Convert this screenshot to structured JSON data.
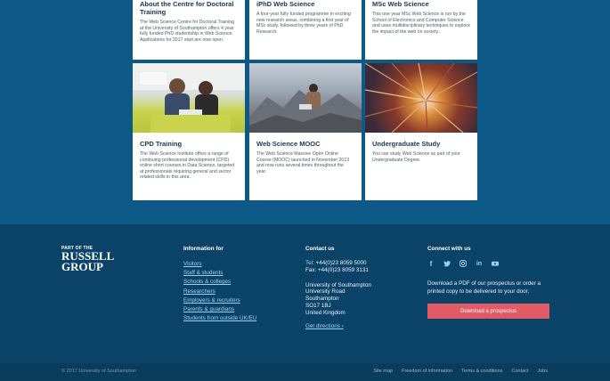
{
  "cards": [
    {
      "title": "About the Centre for Doctoral Training",
      "text": "The Web Science Centre for Doctoral Training at the University of Southampton offers 4 year fully funded PhD studentship in Web Science. Applications for 2017 start are now open."
    },
    {
      "title": "iPhD Web Science",
      "text": "A four-year fully funded programme in exciting new research areas, combining a first year of MSc study, followed by three years of PhD Research."
    },
    {
      "title": "MSc Web Science",
      "text": "This one year MSc Web Science is run by the School of Electronics and Computer Science and uses multidisciplinary techniques to explore the impact of the web on society."
    },
    {
      "title": "CPD Training",
      "text": "The Web Science Institute offers a range of continuing professional development (CPD) online short courses in Data Science, targeted at professionals requiring general and sector related skills in this area."
    },
    {
      "title": "Web Science MOOC",
      "text": "The Web Science Massive Open Online Course (MOOC) launched in November 2013 and now runs several times throughout the year."
    },
    {
      "title": "Undergraduate Study",
      "text": "You can study Web Science as part of your Undergraduate Degree."
    }
  ],
  "footer": {
    "russell_part": "PART OF THE",
    "russell_1": "RUSSELL",
    "russell_2": "GROUP",
    "info_heading": "Information for",
    "info_links": [
      "Visitors",
      "Staff & students",
      "Schools & colleges",
      "Researchers",
      "Employers & recruiters",
      "Parents & guardians",
      "Students from outside UK/EU"
    ],
    "contact_heading": "Contact us",
    "tel_label": "Tel:",
    "tel": "+44(0)23 8059 5000",
    "fax_label": "Fax:",
    "fax": "+44(0)23 8059 3131",
    "address": [
      "University of Southampton",
      "University Road",
      "Southampton",
      "SO17 1BJ",
      "United Kingdom"
    ],
    "directions": "Get directions ›",
    "connect_heading": "Connect with us",
    "social_icons": [
      "facebook-icon",
      "twitter-icon",
      "instagram-icon",
      "linkedin-icon",
      "youtube-icon"
    ],
    "download_text": "Download a PDF of our prospectus or order a printed copy to be delivered to your door.",
    "download_button": "Download a prospectus",
    "copyright": "© 2017 University of Southampton",
    "bottom_links": [
      "Site map",
      "Freedom of information",
      "Terms & conditions",
      "Contact",
      "Jobs"
    ]
  },
  "colors": {
    "band": "#0d5a88",
    "footer": "#0b4368",
    "accent": "#e15b67",
    "link": "#9fd0f3"
  }
}
